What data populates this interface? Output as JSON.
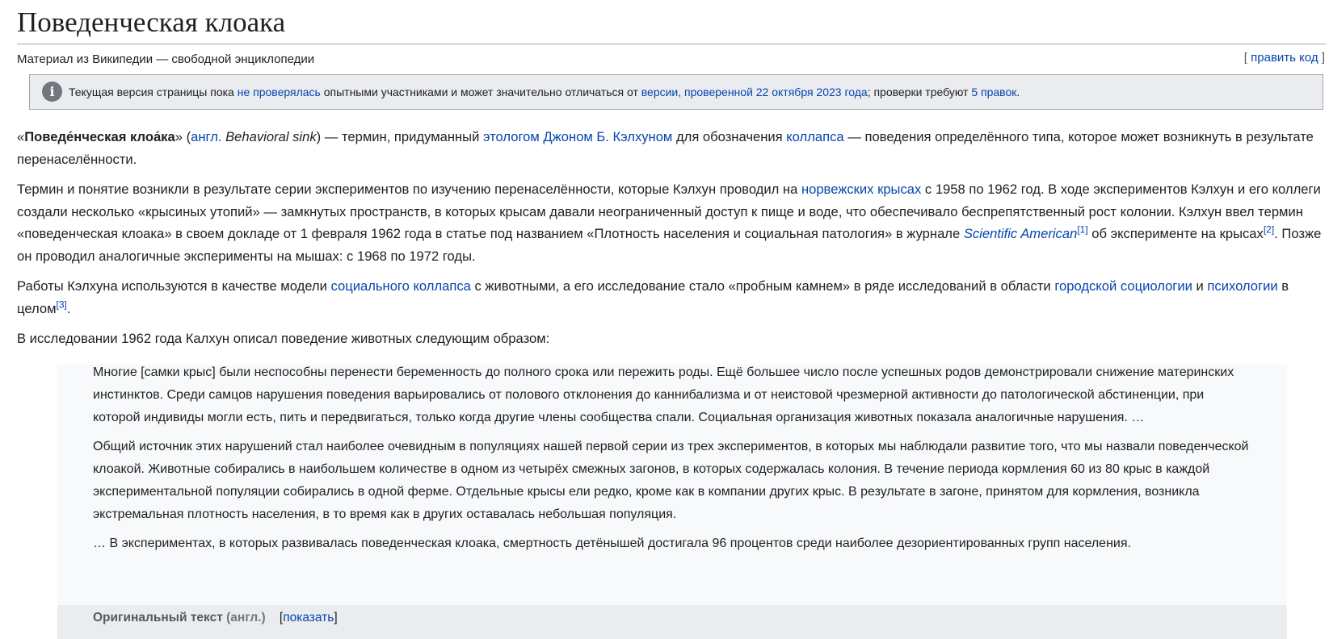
{
  "title": "Поведенческая клоака",
  "subtitle": "Материал из Википедии — свободной энциклопедии",
  "edit": {
    "open": "[ ",
    "label": "править код",
    "close": " ]"
  },
  "notice": {
    "icon": "info-icon",
    "t1": "Текущая версия страницы пока ",
    "l1": "не проверялась",
    "t2": " опытными участниками и может значительно отличаться от ",
    "l2": "версии, проверенной 22 октября 2023 года",
    "t3": "; проверки требуют ",
    "l3": "5 правок",
    "t4": "."
  },
  "p1": {
    "open_quote": "«",
    "term": "Поведе́нческая клоа́ка",
    "mid": "» (",
    "lang_link": "англ.",
    "space": " ",
    "foreign": "Behavioral sink",
    "t1": ") — термин, придуманный ",
    "l1": "этологом",
    "sp": " ",
    "l2": "Джоном Б. Кэлхуном",
    "t2": " для обозначения ",
    "l3": "коллапса",
    "t3": " — поведения определённого типа, которое может возникнуть в результате перенаселённости."
  },
  "p2": {
    "t1": "Термин и понятие возникли в результате серии экспериментов по изучению перенаселённости, которые Кэлхун проводил на ",
    "l1": "норвежских крысах",
    "t2": " с 1958 по 1962 год. В ходе экспериментов Кэлхун и его коллеги создали несколько «крысиных утопий» — замкнутых пространств, в которых крысам давали неограниченный доступ к пище и воде, что обеспечивало беспрепятственный рост колонии. Кэлхун ввел термин «поведенческая клоака» в своем докладе от 1 февраля 1962 года в статье под названием «Плотность населения и социальная патология» в журнале ",
    "l2": "Scientific American",
    "ref1": "[1]",
    "t3": " об эксперименте на крысах",
    "ref2": "[2]",
    "t4": ". Позже он проводил аналогичные эксперименты на мышах: с 1968 по 1972 годы."
  },
  "p3": {
    "t1": "Работы Кэлхуна используются в качестве модели ",
    "l1": "социального коллапса",
    "t2": " с животными, а его исследование стало «пробным камнем» в ряде исследований в области ",
    "l2": "городской социологии",
    "t3": " и ",
    "l3": "психологии",
    "t4": " в целом",
    "ref3": "[3]",
    "t5": "."
  },
  "p4": "В исследовании 1962 года Калхун описал поведение животных следующим образом:",
  "quote": {
    "q1": "Многие [самки крыс] были неспособны перенести беременность до полного срока или пережить роды. Ещё большее число после успешных родов демонстрировали снижение материнских инстинктов. Среди самцов нарушения поведения варьировались от полового отклонения до каннибализма и от неистовой чрезмерной активности до патологической абстиненции, при которой индивиды могли есть, пить и передвигаться, только когда другие члены сообщества спали. Социальная организация животных показала аналогичные нарушения. …",
    "q2": "Общий источник этих нарушений стал наиболее очевидным в популяциях нашей первой серии из трех экспериментов, в которых мы наблюдали развитие того, что мы назвали поведенческой клоакой. Животные собирались в наибольшем количестве в одном из четырёх смежных загонов, в которых содержалась колония. В течение периода кормления 60 из 80 крыс в каждой экспериментальной популяции собирались в одной ферме. Отдельные крысы ели редко, кроме как в компании других крыс. В результате в загоне, принятом для кормления, возникла экстремальная плотность населения, в то время как в других оставалась небольшая популяция.",
    "q3": "… В экспериментах, в которых развивалась поведенческая клоака, смертность детёнышей достигала 96 процентов среди наиболее дезориентированных групп населения.",
    "footer_label": "Оригинальный текст",
    "footer_lang": " (англ.)",
    "footer_open": "[",
    "footer_link": "показать",
    "footer_close": "]"
  }
}
